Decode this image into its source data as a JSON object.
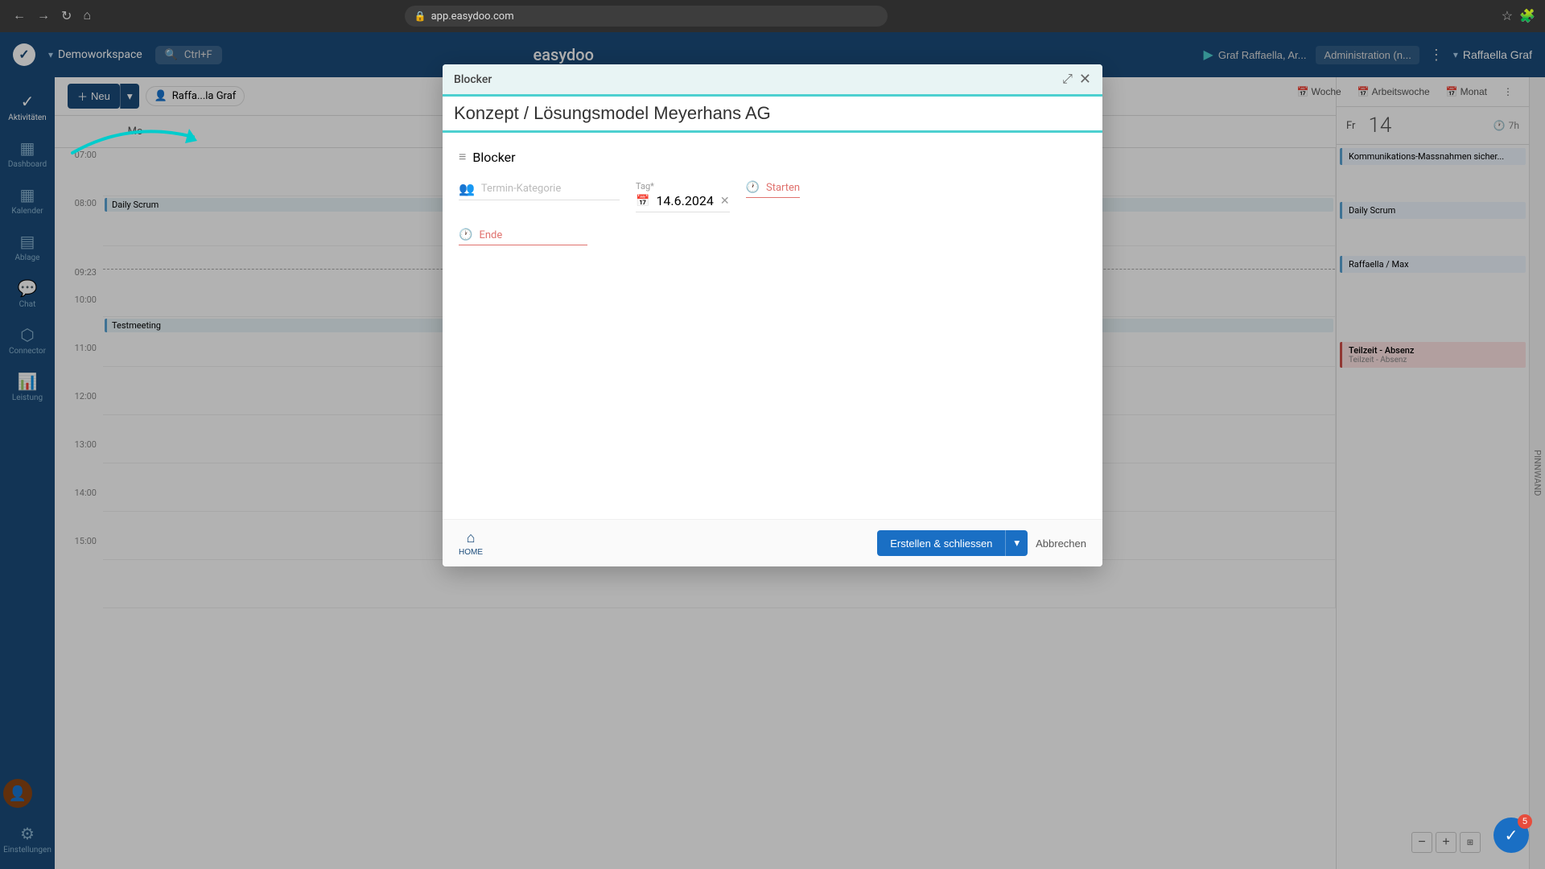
{
  "browser": {
    "url": "app.easydoo.com",
    "back_label": "←",
    "forward_label": "→",
    "refresh_label": "↻",
    "home_label": "⌂"
  },
  "app": {
    "title": "easydoo",
    "workspace": "Demoworkspace",
    "search_shortcut": "Ctrl+F",
    "user_display": "Graf Raffaella, Ar...",
    "admin_label": "Administration (n...",
    "username": "Raffaella Graf"
  },
  "sidebar": {
    "items": [
      {
        "id": "aktivitaten",
        "label": "Aktivitäten",
        "icon": "✓"
      },
      {
        "id": "dashboard",
        "label": "Dashboard",
        "icon": "▦"
      },
      {
        "id": "kalender",
        "label": "Kalender",
        "icon": "📅"
      },
      {
        "id": "ablage",
        "label": "Ablage",
        "icon": "📂"
      },
      {
        "id": "chat",
        "label": "Chat",
        "icon": "💬"
      },
      {
        "id": "connector",
        "label": "Connector",
        "icon": "⬡"
      },
      {
        "id": "leistung",
        "label": "Leistung",
        "icon": "📊"
      }
    ],
    "settings_label": "Einstellungen",
    "settings_icon": "⚙"
  },
  "calendar": {
    "new_btn": "Neu",
    "user_filter": "Raffa...la Graf",
    "view_buttons": [
      {
        "label": "Woche",
        "icon": "📅"
      },
      {
        "label": "Arbeitswoche",
        "icon": "📅"
      },
      {
        "label": "Monat",
        "icon": "📅"
      }
    ],
    "time_label": "7h",
    "day_header": "Mo",
    "fri_header": "Fr",
    "fri_date": "14",
    "times": [
      "07:00",
      "08:00",
      "09:23",
      "10:00",
      "11:00",
      "12:00",
      "13:00",
      "14:00",
      "15:00"
    ],
    "events": [
      {
        "time": "08:00",
        "title": "Daily Scrum"
      },
      {
        "time": "10:00",
        "title": "Testmeeting"
      }
    ],
    "right_events": [
      {
        "title": "Kommunikations-Massnahmen sicher...",
        "type": "blue"
      },
      {
        "title": "Daily Scrum",
        "type": "blue"
      },
      {
        "title": "Raffaella / Max",
        "type": "blue"
      },
      {
        "title": "Teilzeit - Absenz",
        "type": "pink",
        "subtitle": "Teilzeit - Absenz"
      }
    ]
  },
  "modal": {
    "header_title": "Blocker",
    "title_value": "Konzept / Lösungsmodel Meyerhans AG",
    "type_icon_label": "list-icon",
    "type_label": "Blocker",
    "category_placeholder": "Termin-Kategorie",
    "date_label": "Tag*",
    "date_value": "14.6.2024",
    "start_placeholder": "Starten",
    "end_placeholder": "Ende",
    "home_tab_label": "HOME",
    "create_close_btn": "Erstellen & schliessen",
    "cancel_btn": "Abbrechen"
  },
  "notifications": {
    "badge_count": "0",
    "task_badge_count": "5"
  }
}
